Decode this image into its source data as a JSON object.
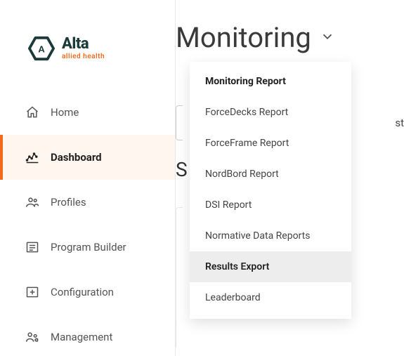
{
  "brand": {
    "title": "Alta",
    "subtitle": "allied health"
  },
  "sidebar": {
    "items": [
      {
        "label": "Home",
        "icon": "home-icon"
      },
      {
        "label": "Dashboard",
        "icon": "chart-icon"
      },
      {
        "label": "Profiles",
        "icon": "profiles-icon"
      },
      {
        "label": "Program Builder",
        "icon": "program-icon"
      },
      {
        "label": "Configuration",
        "icon": "config-icon"
      },
      {
        "label": "Management",
        "icon": "management-icon"
      }
    ],
    "active_index": 1
  },
  "main": {
    "heading": "Monitoring",
    "partial_text_right": "st",
    "partial_text_s": "S"
  },
  "dropdown": {
    "header": "Monitoring Report",
    "items": [
      "ForceDecks Report",
      "ForceFrame Report",
      "NordBord Report",
      "DSI Report",
      "Normative Data Reports",
      "Results Export",
      "Leaderboard"
    ],
    "highlight_index": 5
  }
}
